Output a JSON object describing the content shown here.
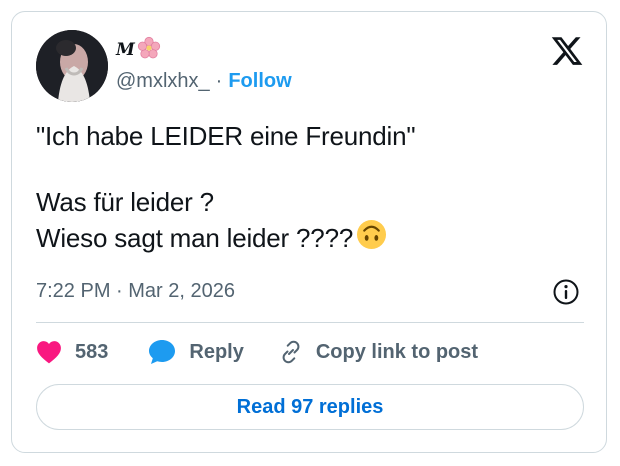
{
  "author": {
    "display_name": "M",
    "display_name_emoji": "cherry-blossom",
    "handle": "@mxlxhx_",
    "separator": "·",
    "follow_label": "Follow"
  },
  "tweet": {
    "line1": "\"Ich habe LEIDER eine Freundin\"",
    "line2": "Was für leider ?",
    "line3": "Wieso sagt man leider ????",
    "line3_emoji": "upside-down-face",
    "timestamp": "7:22 PM · Mar 2, 2026"
  },
  "actions": {
    "likes": "583",
    "reply_label": "Reply",
    "copy_link_label": "Copy link to post"
  },
  "read_replies_label": "Read 97 replies",
  "colors": {
    "accent": "#1d9bf0",
    "read_replies_text": "#006fd6",
    "like": "#f91880",
    "reply_bubble": "#1d9bf0",
    "secondary_text": "#536471",
    "border": "#cfd9de"
  }
}
